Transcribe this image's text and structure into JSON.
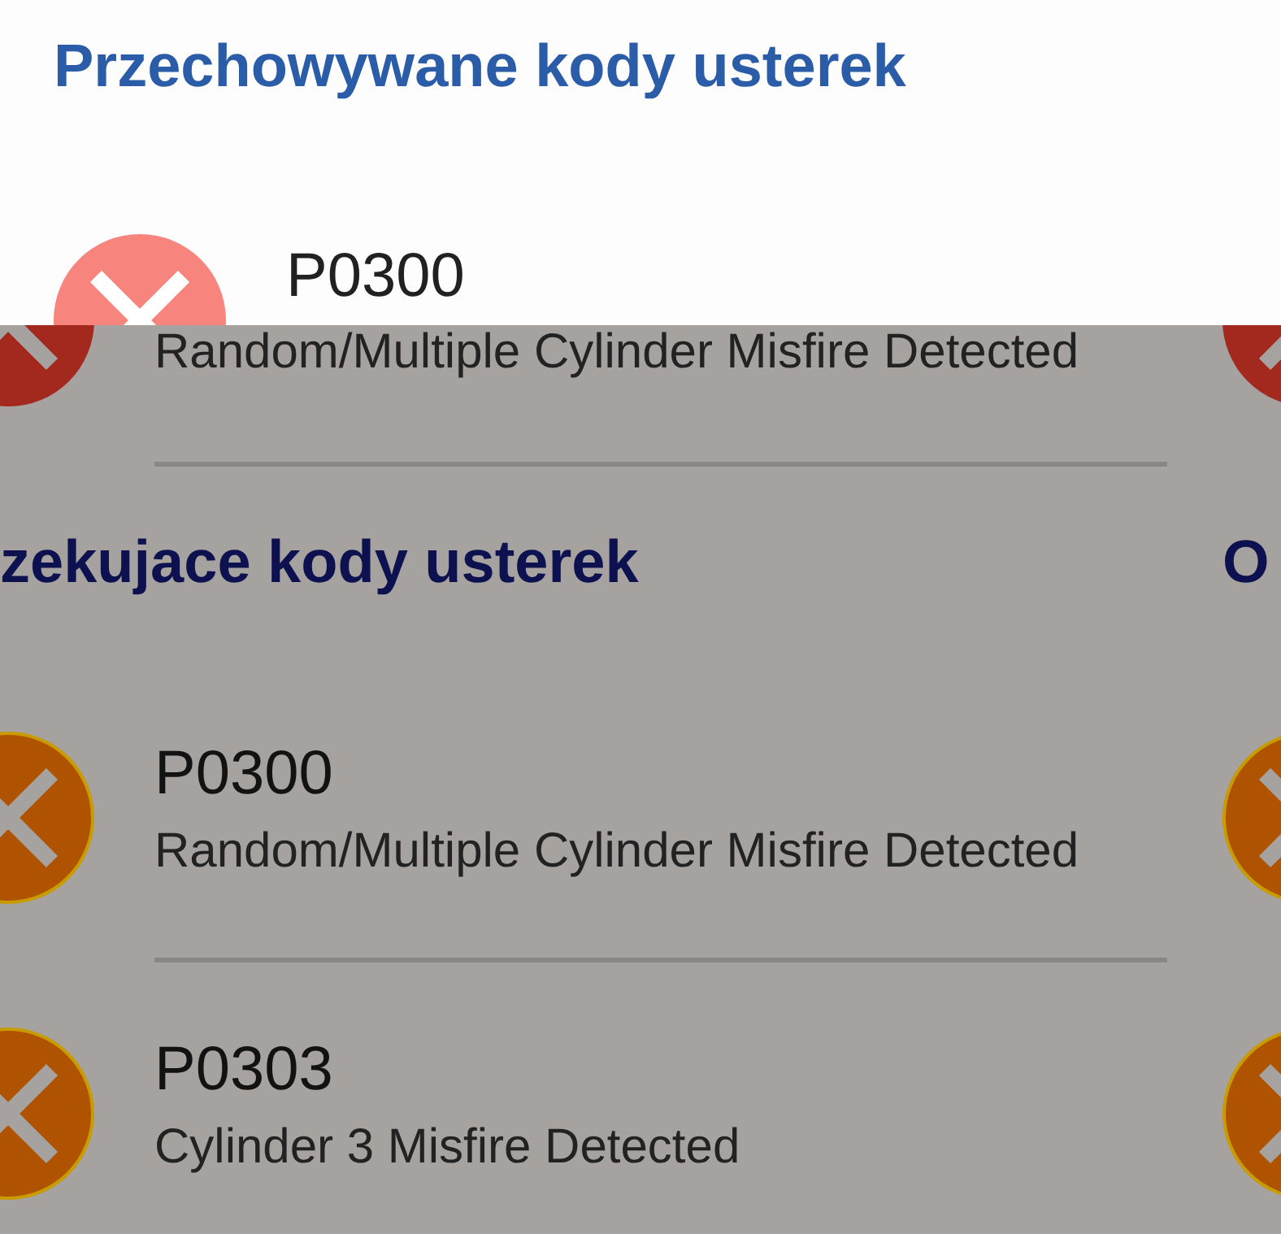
{
  "stored_panel": {
    "title": "Przechowywane kody usterek",
    "codes": [
      {
        "kind": "stored",
        "code": "P0300"
      }
    ]
  },
  "dimmed_view": {
    "pages": [
      {
        "stored_codes": [
          {
            "kind": "stored",
            "description": "Random/Multiple Cylinder Misfire Detected"
          }
        ],
        "pending_title": "zekujace kody usterek",
        "pending_codes": [
          {
            "kind": "pending",
            "code": "P0300",
            "description": "Random/Multiple Cylinder Misfire Detected"
          },
          {
            "kind": "pending",
            "code": "P0303",
            "description": "Cylinder 3 Misfire Detected"
          }
        ]
      },
      {
        "stored_codes": [
          {
            "kind": "stored"
          }
        ],
        "pending_title": "O",
        "pending_codes": [
          {
            "kind": "pending"
          },
          {
            "kind": "pending"
          }
        ]
      }
    ]
  }
}
